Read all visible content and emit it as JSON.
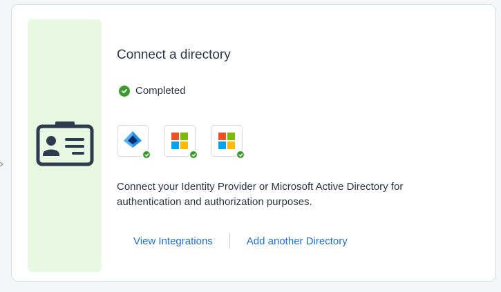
{
  "card": {
    "title": "Connect a directory",
    "status": {
      "label": "Completed",
      "icon": "check-circle-icon",
      "color": "#3a9a2c"
    },
    "hero_icon": "id-card-icon",
    "side_panel_color": "#e8f8e2",
    "integrations": [
      {
        "name": "azure-ad-logo",
        "connected": true
      },
      {
        "name": "microsoft-logo",
        "connected": true
      },
      {
        "name": "microsoft-logo",
        "connected": true
      }
    ],
    "description": "Connect your Identity Provider or Microsoft Active Directory for authentication and authorization purposes.",
    "actions": {
      "view_integrations": "View Integrations",
      "add_directory": "Add another Directory"
    },
    "link_color": "#1b6fd6"
  }
}
